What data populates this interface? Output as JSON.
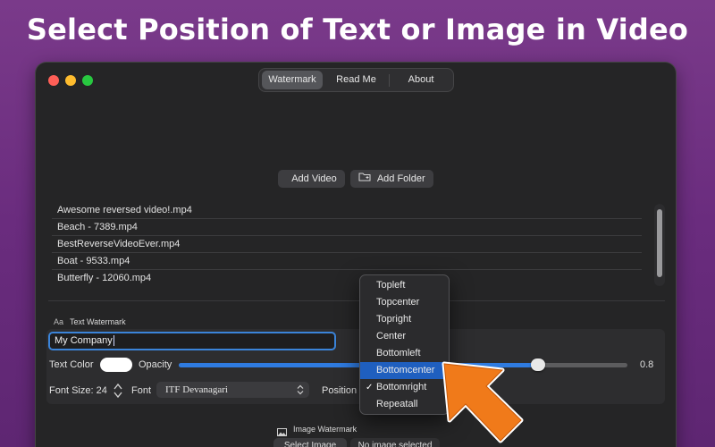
{
  "headline": "Select Position of Text or Image in Video",
  "window": {
    "tabs": [
      {
        "label": "Watermark",
        "selected": true
      },
      {
        "label": "Read Me",
        "selected": false
      },
      {
        "label": "About",
        "selected": false
      }
    ]
  },
  "toolbar": {
    "add_video_label": "Add Video",
    "add_folder_label": "Add Folder"
  },
  "file_list": [
    "Awesome reversed video!.mp4",
    "Beach - 7389.mp4",
    "BestReverseVideoEver.mp4",
    "Boat - 9533.mp4",
    "Butterfly - 12060.mp4"
  ],
  "text_watermark": {
    "icon_label": "Aa",
    "section_title": "Text Watermark",
    "text_value": "My Company",
    "text_color_label": "Text Color",
    "text_color": "#ffffff",
    "opacity_label": "Opacity",
    "opacity_value": "0.8",
    "font_size_label": "Font Size: 24",
    "font_label": "Font",
    "font_value": "ITF Devanagari",
    "position_label": "Position",
    "position_value": "Bottomright"
  },
  "position_menu": {
    "options": [
      "Topleft",
      "Topcenter",
      "Topright",
      "Center",
      "Bottomleft",
      "Bottomcenter",
      "Bottomright",
      "Repeatall"
    ],
    "checked": "Bottomright",
    "highlighted": "Bottomcenter"
  },
  "image_watermark": {
    "section_title": "Image Watermark",
    "select_button_label": "Select Image",
    "no_image_label": "No image selected"
  },
  "colors": {
    "accent": "#2f7be0",
    "menu_highlight": "#1f5fbf",
    "arrow": "#f07a1a"
  }
}
